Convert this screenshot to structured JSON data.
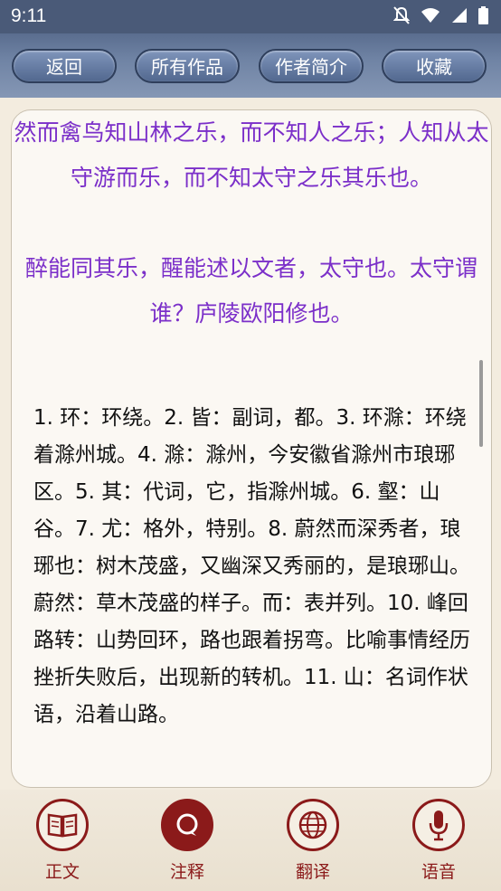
{
  "status_bar": {
    "time": "9:11",
    "icons": [
      "notifications-off-icon",
      "wifi-icon",
      "signal-icon",
      "battery-icon"
    ]
  },
  "toolbar": {
    "back": "返回",
    "all_works": "所有作品",
    "author_intro": "作者简介",
    "favorite": "收藏"
  },
  "content": {
    "para1": "然而禽鸟知山林之乐，而不知人之乐；人知从太守游而乐，而不知太守之乐其乐也。",
    "para2": "醉能同其乐，醒能述以文者，太守也。太守谓谁？庐陵欧阳修也。",
    "notes": "1. 环：环绕。2. 皆：副词，都。3. 环滁：环绕着滁州城。4. 滁：滁州，今安徽省滁州市琅琊区。5. 其：代词，它，指滁州城。6. 壑：山谷。7. 尤：格外，特别。8. 蔚然而深秀者，琅琊也：树木茂盛，又幽深又秀丽的，是琅琊山。蔚然：草木茂盛的样子。而：表并列。10. 峰回路转：山势回环，路也跟着拐弯。比喻事情经历挫折失败后，出现新的转机。11. 山：名词作状语，沿着山路。"
  },
  "bottom_nav": {
    "items": [
      {
        "label": "正文",
        "icon": "book-icon"
      },
      {
        "label": "注释",
        "icon": "speech-bubble-icon"
      },
      {
        "label": "翻译",
        "icon": "globe-icon"
      },
      {
        "label": "语音",
        "icon": "microphone-icon"
      }
    ],
    "active": "注释",
    "accent": "#8b1a1a"
  },
  "colors": {
    "poem_text": "#7b2fc9",
    "toolbar": "#6f83a4"
  }
}
